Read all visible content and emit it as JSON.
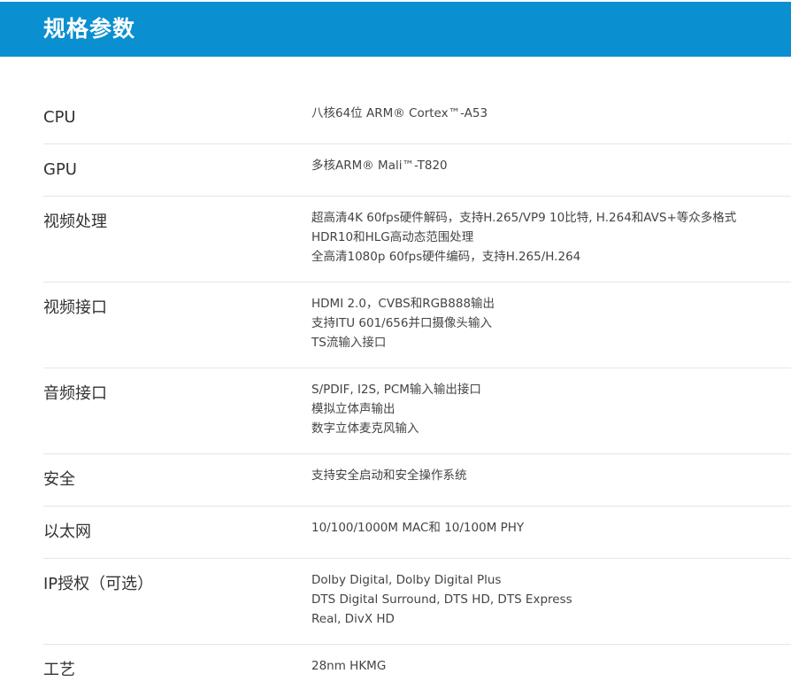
{
  "header": {
    "title": "规格参数"
  },
  "specs": [
    {
      "label": "CPU",
      "lines": [
        "八核64位 ARM® Cortex™-A53"
      ]
    },
    {
      "label": "GPU",
      "lines": [
        "多核ARM® Mali™-T820"
      ]
    },
    {
      "label": "视频处理",
      "lines": [
        "超高清4K 60fps硬件解码，支持H.265/VP9 10比特, H.264和AVS+等众多格式",
        "HDR10和HLG高动态范围处理",
        "全高清1080p 60fps硬件编码，支持H.265/H.264"
      ]
    },
    {
      "label": "视频接口",
      "lines": [
        "HDMI 2.0，CVBS和RGB888输出",
        "支持ITU 601/656并口摄像头输入",
        "TS流输入接口"
      ]
    },
    {
      "label": "音频接口",
      "lines": [
        "S/PDIF, I2S, PCM输入输出接口",
        "模拟立体声输出",
        "数字立体麦克风输入"
      ]
    },
    {
      "label": "安全",
      "lines": [
        "支持安全启动和安全操作系统"
      ]
    },
    {
      "label": "以太网",
      "lines": [
        "10/100/1000M MAC和 10/100M PHY"
      ]
    },
    {
      "label": "IP授权（可选）",
      "lines": [
        "Dolby Digital, Dolby Digital Plus",
        "DTS Digital Surround, DTS HD, DTS Express",
        "Real, DivX HD"
      ]
    },
    {
      "label": "工艺",
      "lines": [
        "28nm HKMG"
      ]
    }
  ]
}
